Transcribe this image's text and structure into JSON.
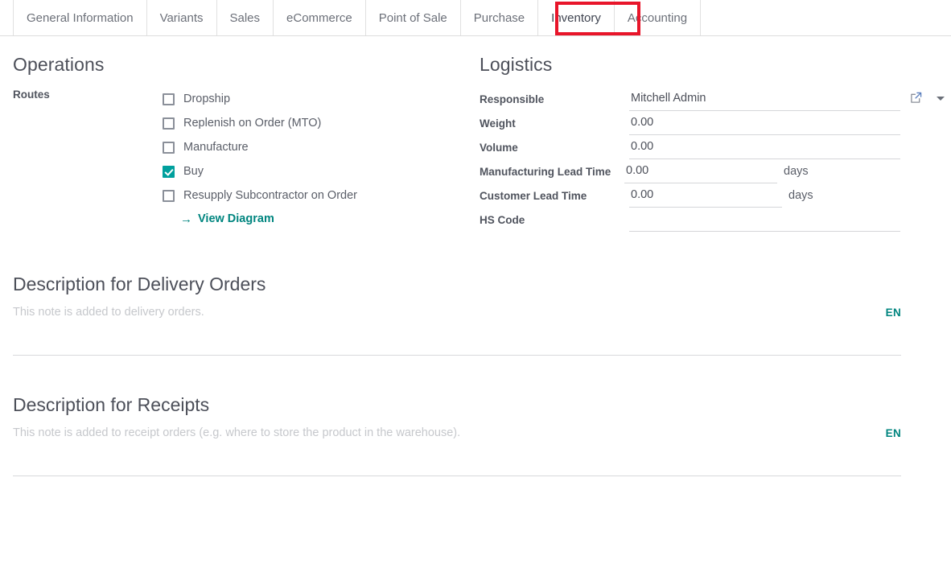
{
  "tabs": [
    {
      "label": "General Information",
      "active": false
    },
    {
      "label": "Variants",
      "active": false
    },
    {
      "label": "Sales",
      "active": false
    },
    {
      "label": "eCommerce",
      "active": false
    },
    {
      "label": "Point of Sale",
      "active": false
    },
    {
      "label": "Purchase",
      "active": false
    },
    {
      "label": "Inventory",
      "active": true
    },
    {
      "label": "Accounting",
      "active": false
    }
  ],
  "highlight": {
    "target_tab": "Inventory",
    "color": "#e8152a"
  },
  "operations": {
    "title": "Operations",
    "routes_label": "Routes",
    "routes": [
      {
        "label": "Dropship",
        "checked": false
      },
      {
        "label": "Replenish on Order (MTO)",
        "checked": false
      },
      {
        "label": "Manufacture",
        "checked": false
      },
      {
        "label": "Buy",
        "checked": true
      },
      {
        "label": "Resupply Subcontractor on Order",
        "checked": false
      }
    ],
    "view_diagram_label": "View Diagram",
    "view_diagram_arrow": "→"
  },
  "logistics": {
    "title": "Logistics",
    "fields": [
      {
        "label": "Responsible",
        "value": "Mitchell Admin",
        "unit": ""
      },
      {
        "label": "Weight",
        "value": "0.00",
        "unit": ""
      },
      {
        "label": "Volume",
        "value": "0.00",
        "unit": ""
      },
      {
        "label": "Manufacturing Lead Time",
        "value": "0.00",
        "unit": "days"
      },
      {
        "label": "Customer Lead Time",
        "value": "0.00",
        "unit": "days"
      },
      {
        "label": "HS Code",
        "value": "",
        "unit": ""
      }
    ]
  },
  "delivery_description": {
    "title": "Description for Delivery Orders",
    "placeholder": "This note is added to delivery orders.",
    "value": "",
    "language_badge": "EN"
  },
  "receipt_description": {
    "title": "Description for Receipts",
    "placeholder": "This note is added to receipt orders (e.g. where to store the product in the warehouse).",
    "value": "",
    "language_badge": "EN"
  },
  "theme": {
    "accent": "#00a09d",
    "link": "#00857f",
    "text": "#4c4f59",
    "placeholder": "#c6c8cc"
  }
}
